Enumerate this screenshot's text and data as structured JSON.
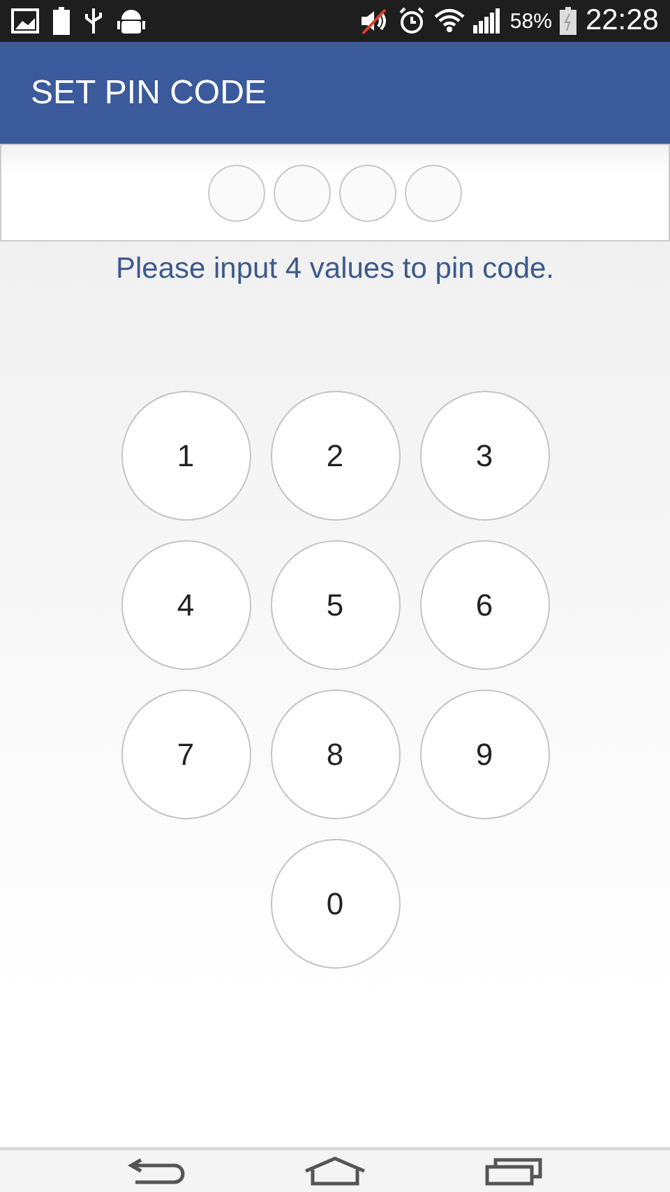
{
  "status_bar": {
    "battery_percent": "58%",
    "time": "22:28"
  },
  "header": {
    "title": "SET PIN CODE"
  },
  "pin_dots": [
    {
      "filled": false
    },
    {
      "filled": false
    },
    {
      "filled": false
    },
    {
      "filled": false
    }
  ],
  "message": "Please input 4 values to pin code.",
  "keys": [
    "1",
    "2",
    "3",
    "4",
    "5",
    "6",
    "7",
    "8",
    "9",
    "0"
  ]
}
